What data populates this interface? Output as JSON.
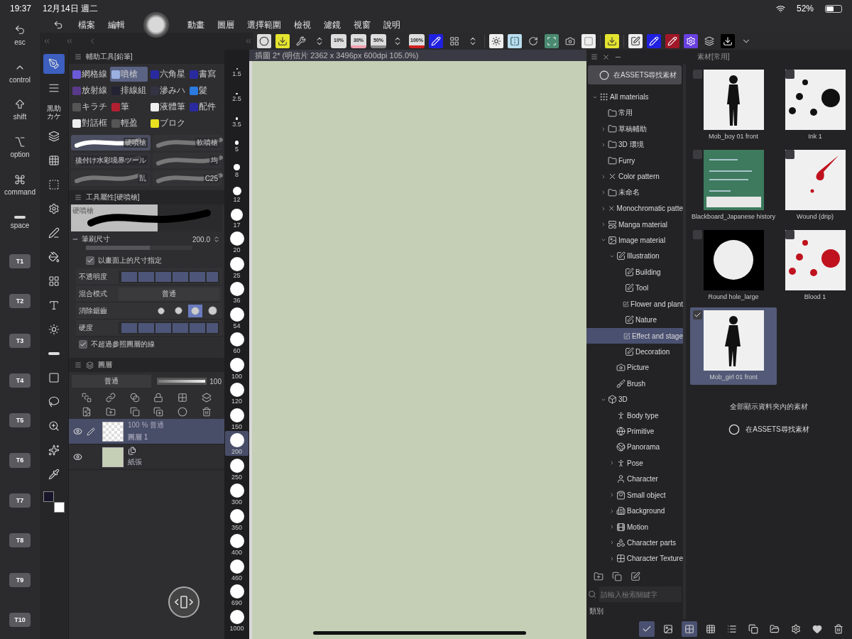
{
  "status_bar": {
    "time": "19:37",
    "date": "12月14日 週二",
    "battery": "52%"
  },
  "keys": [
    {
      "kind": "modifier",
      "label": "esc"
    },
    {
      "kind": "modifier",
      "label": "control"
    },
    {
      "kind": "modifier",
      "label": "shift"
    },
    {
      "kind": "modifier",
      "label": "option"
    },
    {
      "kind": "modifier",
      "label": "command"
    },
    {
      "kind": "modifier",
      "label": "space"
    },
    {
      "kind": "shortcut",
      "label": "T1"
    },
    {
      "kind": "shortcut",
      "label": "T2"
    },
    {
      "kind": "shortcut",
      "label": "T3"
    },
    {
      "kind": "shortcut",
      "label": "T4"
    },
    {
      "kind": "shortcut",
      "label": "T5"
    },
    {
      "kind": "shortcut",
      "label": "T6"
    },
    {
      "kind": "shortcut",
      "label": "T7"
    },
    {
      "kind": "shortcut",
      "label": "T8"
    },
    {
      "kind": "shortcut",
      "label": "T9"
    },
    {
      "kind": "shortcut",
      "label": "T10"
    }
  ],
  "menu": [
    "檔案",
    "編輯",
    "動畫",
    "圖層",
    "選擇範圍",
    "檢視",
    "濾鏡",
    "視窗",
    "說明"
  ],
  "toolbar": {
    "zoom_presets": [
      "10%",
      "30%",
      "50%",
      "100%"
    ]
  },
  "tools": [
    {
      "selected": true
    },
    {
      "selected": false
    },
    {
      "selected": false,
      "label": "黒助カケ"
    },
    {
      "selected": false
    },
    {
      "selected": false
    },
    {
      "selected": false
    },
    {
      "selected": false
    },
    {
      "selected": false
    },
    {
      "selected": false
    },
    {
      "selected": false
    },
    {
      "selected": false
    },
    {
      "selected": false
    },
    {
      "selected": false
    },
    {
      "selected": false
    },
    {
      "selected": false
    },
    {
      "selected": false
    },
    {
      "selected": false
    },
    {
      "selected": false
    }
  ],
  "color_swatches": [
    {
      "color": "#16152a"
    },
    {
      "color": "#ffffff"
    }
  ],
  "sub_tool": {
    "title": "輔助工具[鉛筆]",
    "items": [
      {
        "label": "網格線",
        "selected": false
      },
      {
        "label": "噴槍",
        "selected": true
      },
      {
        "label": "六角星",
        "selected": false
      },
      {
        "label": "書寫",
        "selected": false
      },
      {
        "label": "放射線",
        "selected": false
      },
      {
        "label": "排線組",
        "selected": false
      },
      {
        "label": "滲みハ",
        "selected": false
      },
      {
        "label": "髮",
        "selected": false
      },
      {
        "label": "キラチ",
        "selected": false
      },
      {
        "label": "筆",
        "selected": false
      },
      {
        "label": "液體筆",
        "selected": false
      },
      {
        "label": "配件",
        "selected": false
      },
      {
        "label": "對話框",
        "selected": false
      },
      {
        "label": "輕盈",
        "selected": false
      },
      {
        "label": "ブロク",
        "selected": false
      }
    ],
    "brushes": [
      {
        "label": "硬噴槍",
        "selected": true
      },
      {
        "label": "軟噴槍",
        "selected": false
      },
      {
        "label": "後付け水彩境界ツール",
        "selected": false
      },
      {
        "label": "均",
        "selected": false
      },
      {
        "label": "乱",
        "selected": false
      },
      {
        "label": "C25",
        "selected": false
      }
    ]
  },
  "tool_property": {
    "title": "工具屬性[硬噴槍]",
    "preview_label": "硬噴槍",
    "brush_size": {
      "label": "筆刷尺寸",
      "value": "200.0",
      "level": 0.6
    },
    "screen_size": {
      "label": "以畫面上的尺寸指定",
      "checked": true
    },
    "opacity": {
      "label": "不透明度",
      "level": 1
    },
    "blend": {
      "label": "混合模式",
      "value": "普通"
    },
    "antialias": {
      "label": "消除鋸齒",
      "options": [
        {
          "selected": false
        },
        {
          "selected": false
        },
        {
          "selected": true
        },
        {
          "selected": false
        }
      ]
    },
    "hardness": {
      "label": "硬度",
      "level": 1
    },
    "ref_layer": {
      "label": "不超過參照圖層的線",
      "checked": true
    }
  },
  "layers": {
    "title": "圖層",
    "blend": "普通",
    "opacity": "100",
    "level": 1,
    "items": [
      {
        "kind": "raster",
        "info": "100 % 普通",
        "name": "圖層 1",
        "visible": true,
        "selected": true
      },
      {
        "kind": "paper",
        "name": "紙張",
        "visible": true,
        "selected": false
      }
    ]
  },
  "sizes": [
    {
      "label": "1.5",
      "selected": false
    },
    {
      "label": "2.5",
      "selected": false
    },
    {
      "label": "3.5",
      "selected": false
    },
    {
      "label": "5",
      "selected": false
    },
    {
      "label": "8",
      "selected": false
    },
    {
      "label": "12",
      "selected": false
    },
    {
      "label": "17",
      "selected": false
    },
    {
      "label": "20",
      "selected": false
    },
    {
      "label": "25",
      "selected": false
    },
    {
      "label": "36",
      "selected": false
    },
    {
      "label": "54",
      "selected": false
    },
    {
      "label": "60",
      "selected": false
    },
    {
      "label": "100",
      "selected": false
    },
    {
      "label": "120",
      "selected": false
    },
    {
      "label": "150",
      "selected": false
    },
    {
      "label": "200",
      "selected": true
    },
    {
      "label": "250",
      "selected": false
    },
    {
      "label": "300",
      "selected": false
    },
    {
      "label": "350",
      "selected": false
    },
    {
      "label": "400",
      "selected": false
    },
    {
      "label": "460",
      "selected": false
    },
    {
      "label": "690",
      "selected": false
    },
    {
      "label": "1000",
      "selected": false
    }
  ],
  "canvas": {
    "tab": "插圖 2* (明信片 2362 x 3496px 600dpi 105.0%)"
  },
  "materials": {
    "title": "素材[常用]",
    "assets_button": "在ASSETS尋找素材",
    "tree": [
      {
        "label": "All materials",
        "kind": "grid",
        "expanded": true,
        "selected": false,
        "children": [
          {
            "label": "常用",
            "kind": "folder",
            "selected": false
          },
          {
            "label": "草稿輔助",
            "kind": "folder",
            "expanded": false,
            "selected": false
          },
          {
            "label": "3D 環境",
            "kind": "folder",
            "expanded": false,
            "selected": false
          },
          {
            "label": "Furry",
            "kind": "folder",
            "selected": false
          },
          {
            "label": "Color pattern",
            "kind": "pattern",
            "expanded": false,
            "selected": false
          },
          {
            "label": "未命名",
            "kind": "folder",
            "expanded": false,
            "selected": false
          },
          {
            "label": "Monochromatic patte",
            "kind": "pattern",
            "expanded": false,
            "selected": false
          },
          {
            "label": "Manga material",
            "kind": "manga",
            "expanded": false,
            "selected": false
          },
          {
            "label": "Image material",
            "kind": "image",
            "expanded": true,
            "selected": false,
            "children": [
              {
                "label": "Illustration",
                "kind": "edit",
                "expanded": true,
                "selected": false,
                "children": [
                  {
                    "label": "Building",
                    "kind": "edit",
                    "selected": false
                  },
                  {
                    "label": "Tool",
                    "kind": "edit",
                    "selected": false
                  },
                  {
                    "label": "Flower and plant",
                    "kind": "edit",
                    "selected": false
                  },
                  {
                    "label": "Nature",
                    "kind": "edit",
                    "selected": false
                  },
                  {
                    "label": "Effect and stage",
                    "kind": "edit",
                    "selected": true
                  },
                  {
                    "label": "Decoration",
                    "kind": "edit",
                    "selected": false
                  }
                ]
              },
              {
                "label": "Picture",
                "kind": "picture",
                "selected": false
              },
              {
                "label": "Brush",
                "kind": "brush",
                "selected": false
              }
            ]
          },
          {
            "label": "3D",
            "kind": "cube",
            "expanded": true,
            "selected": false,
            "children": [
              {
                "label": "Body type",
                "kind": "body",
                "selected": false
              },
              {
                "label": "Primitive",
                "kind": "globe",
                "selected": false
              },
              {
                "label": "Panorama",
                "kind": "dome",
                "selected": false
              },
              {
                "label": "Pose",
                "kind": "pose",
                "expanded": false,
                "selected": false
              },
              {
                "label": "Character",
                "kind": "character",
                "selected": false
              },
              {
                "label": "Small object",
                "kind": "bag",
                "expanded": false,
                "selected": false
              },
              {
                "label": "Background",
                "kind": "building",
                "expanded": false,
                "selected": false
              },
              {
                "label": "Motion",
                "kind": "motion",
                "expanded": false,
                "selected": false
              },
              {
                "label": "Character parts",
                "kind": "parts",
                "expanded": false,
                "selected": false
              },
              {
                "label": "Character Texture",
                "kind": "texture",
                "expanded": false,
                "selected": false
              }
            ]
          }
        ]
      }
    ],
    "search_placeholder": "請輸入檢索關鍵字",
    "category_label": "類別",
    "items": [
      {
        "kind": "boy",
        "name": "Mob_boy 01 front",
        "checked": false,
        "selected": false
      },
      {
        "kind": "ink",
        "name": "Ink 1",
        "checked": false,
        "selected": false
      },
      {
        "kind": "board",
        "name": "Blackboard_Japanese history",
        "checked": false,
        "selected": false
      },
      {
        "kind": "drip",
        "name": "Wound (drip)",
        "checked": false,
        "selected": false
      },
      {
        "kind": "hole",
        "name": "Round hole_large",
        "checked": false,
        "selected": false
      },
      {
        "kind": "blood",
        "name": "Blood 1",
        "checked": false,
        "selected": false
      },
      {
        "kind": "girl",
        "name": "Mob_girl 01 front",
        "checked": true,
        "selected": true
      }
    ],
    "show_all": "全部顯示資料夾內的素材",
    "assets_link": "在ASSETS尋找素材"
  }
}
